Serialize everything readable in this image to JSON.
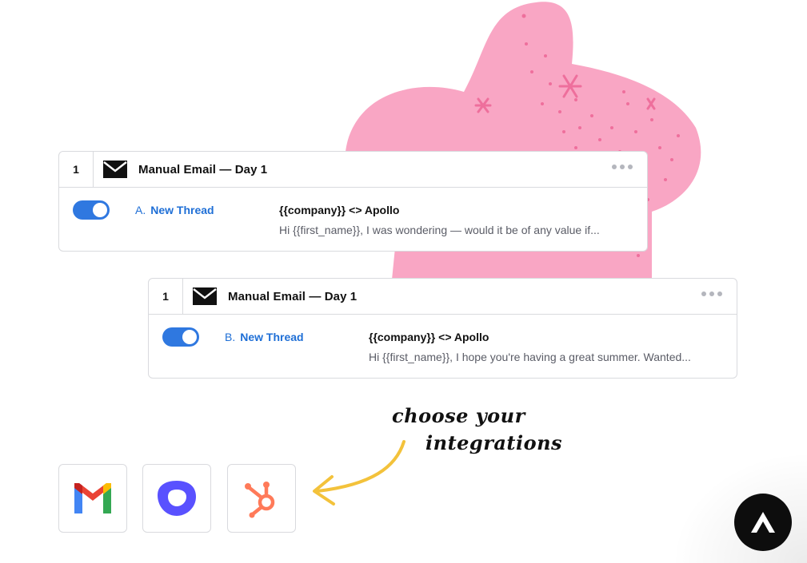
{
  "colors": {
    "blob": "#f9a6c4",
    "blob_speckle": "#ee6f9c",
    "link_blue": "#1f6fd6",
    "toggle_blue": "#2f78e0",
    "arrow_yellow": "#f3c23b"
  },
  "cards": [
    {
      "step": "1",
      "title": "Manual Email — Day 1",
      "icon": "mail-icon",
      "toggle_on": true,
      "variant_letter": "A.",
      "variant_label": "New Thread",
      "subject": "{{company}} <> Apollo",
      "preview": "Hi {{first_name}}, I was wondering — would it be of any value if..."
    },
    {
      "step": "1",
      "title": "Manual Email — Day 1",
      "icon": "mail-icon",
      "toggle_on": true,
      "variant_letter": "B.",
      "variant_label": "New Thread",
      "subject": "{{company}} <> Apollo",
      "preview": "Hi {{first_name}}, I hope you're having a great summer. Wanted..."
    }
  ],
  "annotation": {
    "line1": "choose your",
    "line2": "integrations"
  },
  "integrations": [
    {
      "icon": "gmail-icon"
    },
    {
      "icon": "outreach-icon"
    },
    {
      "icon": "hubspot-icon"
    }
  ],
  "brand_badge": {
    "icon": "apollo-logo-icon"
  }
}
